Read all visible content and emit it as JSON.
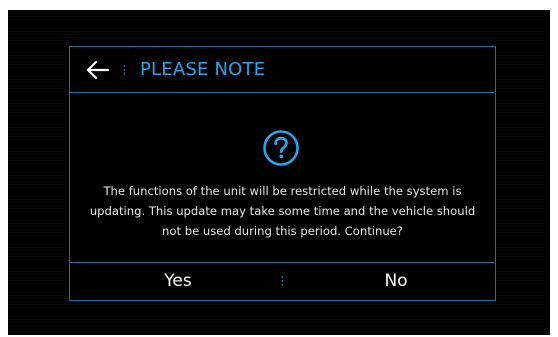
{
  "dialog": {
    "title": "PLEASE NOTE",
    "header_separator": "⁝",
    "back_icon": "arrow-left-icon",
    "status_icon": "question-mark-circle-icon",
    "message": "The functions of the unit will be restricted while the system is updating. This update may take some time and the vehicle should not be used during this period. Continue?",
    "buttons": {
      "yes_label": "Yes",
      "no_label": "No",
      "separator": "⁝"
    }
  },
  "colors": {
    "background": "#000000",
    "accent": "#2aa3e8",
    "border": "#1a6f9e",
    "text": "#e6e6e6"
  }
}
